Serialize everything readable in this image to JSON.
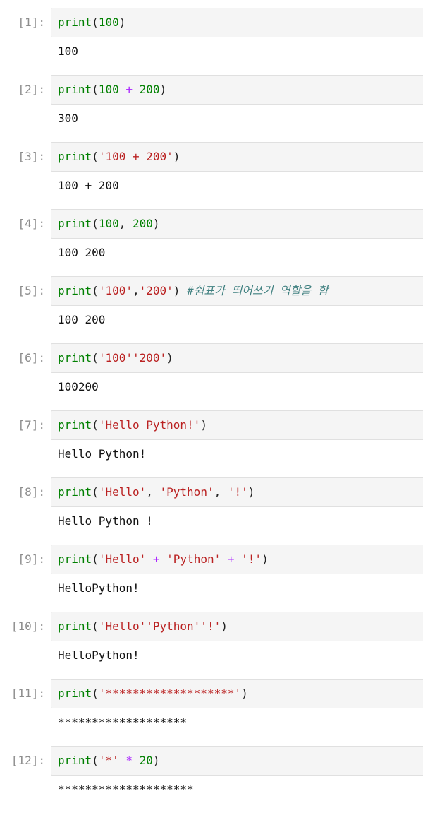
{
  "cells": [
    {
      "prompt": "[1]:",
      "code": [
        {
          "t": "builtin",
          "v": "print"
        },
        {
          "t": "punct",
          "v": "("
        },
        {
          "t": "num",
          "v": "100"
        },
        {
          "t": "punct",
          "v": ")"
        }
      ],
      "output": "100"
    },
    {
      "prompt": "[2]:",
      "code": [
        {
          "t": "builtin",
          "v": "print"
        },
        {
          "t": "punct",
          "v": "("
        },
        {
          "t": "num",
          "v": "100"
        },
        {
          "t": "punct",
          "v": " "
        },
        {
          "t": "op",
          "v": "+"
        },
        {
          "t": "punct",
          "v": " "
        },
        {
          "t": "num",
          "v": "200"
        },
        {
          "t": "punct",
          "v": ")"
        }
      ],
      "output": "300"
    },
    {
      "prompt": "[3]:",
      "code": [
        {
          "t": "builtin",
          "v": "print"
        },
        {
          "t": "punct",
          "v": "("
        },
        {
          "t": "str",
          "v": "'100 + 200'"
        },
        {
          "t": "punct",
          "v": ")"
        }
      ],
      "output": "100 + 200"
    },
    {
      "prompt": "[4]:",
      "code": [
        {
          "t": "builtin",
          "v": "print"
        },
        {
          "t": "punct",
          "v": "("
        },
        {
          "t": "num",
          "v": "100"
        },
        {
          "t": "punct",
          "v": ", "
        },
        {
          "t": "num",
          "v": "200"
        },
        {
          "t": "punct",
          "v": ")"
        }
      ],
      "output": "100 200"
    },
    {
      "prompt": "[5]:",
      "code": [
        {
          "t": "builtin",
          "v": "print"
        },
        {
          "t": "punct",
          "v": "("
        },
        {
          "t": "str",
          "v": "'100'"
        },
        {
          "t": "punct",
          "v": ","
        },
        {
          "t": "str",
          "v": "'200'"
        },
        {
          "t": "punct",
          "v": ") "
        },
        {
          "t": "comment",
          "v": "#쉼표가 띄어쓰기 역할을 함"
        }
      ],
      "output": "100 200"
    },
    {
      "prompt": "[6]:",
      "code": [
        {
          "t": "builtin",
          "v": "print"
        },
        {
          "t": "punct",
          "v": "("
        },
        {
          "t": "str",
          "v": "'100''200'"
        },
        {
          "t": "punct",
          "v": ")"
        }
      ],
      "output": "100200"
    },
    {
      "prompt": "[7]:",
      "code": [
        {
          "t": "builtin",
          "v": "print"
        },
        {
          "t": "punct",
          "v": "("
        },
        {
          "t": "str",
          "v": "'Hello Python!'"
        },
        {
          "t": "punct",
          "v": ")"
        }
      ],
      "output": "Hello Python!"
    },
    {
      "prompt": "[8]:",
      "code": [
        {
          "t": "builtin",
          "v": "print"
        },
        {
          "t": "punct",
          "v": "("
        },
        {
          "t": "str",
          "v": "'Hello'"
        },
        {
          "t": "punct",
          "v": ", "
        },
        {
          "t": "str",
          "v": "'Python'"
        },
        {
          "t": "punct",
          "v": ", "
        },
        {
          "t": "str",
          "v": "'!'"
        },
        {
          "t": "punct",
          "v": ")"
        }
      ],
      "output": "Hello Python !"
    },
    {
      "prompt": "[9]:",
      "code": [
        {
          "t": "builtin",
          "v": "print"
        },
        {
          "t": "punct",
          "v": "("
        },
        {
          "t": "str",
          "v": "'Hello'"
        },
        {
          "t": "punct",
          "v": " "
        },
        {
          "t": "op",
          "v": "+"
        },
        {
          "t": "punct",
          "v": " "
        },
        {
          "t": "str",
          "v": "'Python'"
        },
        {
          "t": "punct",
          "v": " "
        },
        {
          "t": "op",
          "v": "+"
        },
        {
          "t": "punct",
          "v": " "
        },
        {
          "t": "str",
          "v": "'!'"
        },
        {
          "t": "punct",
          "v": ")"
        }
      ],
      "output": "HelloPython!"
    },
    {
      "prompt": "[10]:",
      "code": [
        {
          "t": "builtin",
          "v": "print"
        },
        {
          "t": "punct",
          "v": "("
        },
        {
          "t": "str",
          "v": "'Hello''Python''!'"
        },
        {
          "t": "punct",
          "v": ")"
        }
      ],
      "output": "HelloPython!"
    },
    {
      "prompt": "[11]:",
      "code": [
        {
          "t": "builtin",
          "v": "print"
        },
        {
          "t": "punct",
          "v": "("
        },
        {
          "t": "str",
          "v": "'*******************'"
        },
        {
          "t": "punct",
          "v": ")"
        }
      ],
      "output": "*******************"
    },
    {
      "prompt": "[12]:",
      "code": [
        {
          "t": "builtin",
          "v": "print"
        },
        {
          "t": "punct",
          "v": "("
        },
        {
          "t": "str",
          "v": "'*'"
        },
        {
          "t": "punct",
          "v": " "
        },
        {
          "t": "op",
          "v": "*"
        },
        {
          "t": "punct",
          "v": " "
        },
        {
          "t": "num",
          "v": "20"
        },
        {
          "t": "punct",
          "v": ")"
        }
      ],
      "output": "********************"
    }
  ],
  "colors": {
    "builtin": "#008000",
    "number": "#008000",
    "string": "#ba2121",
    "operator": "#aa22ff",
    "comment": "#408080",
    "prompt": "#8c8c8c",
    "input_background": "#f5f5f5",
    "input_border": "#e0e0e0"
  }
}
